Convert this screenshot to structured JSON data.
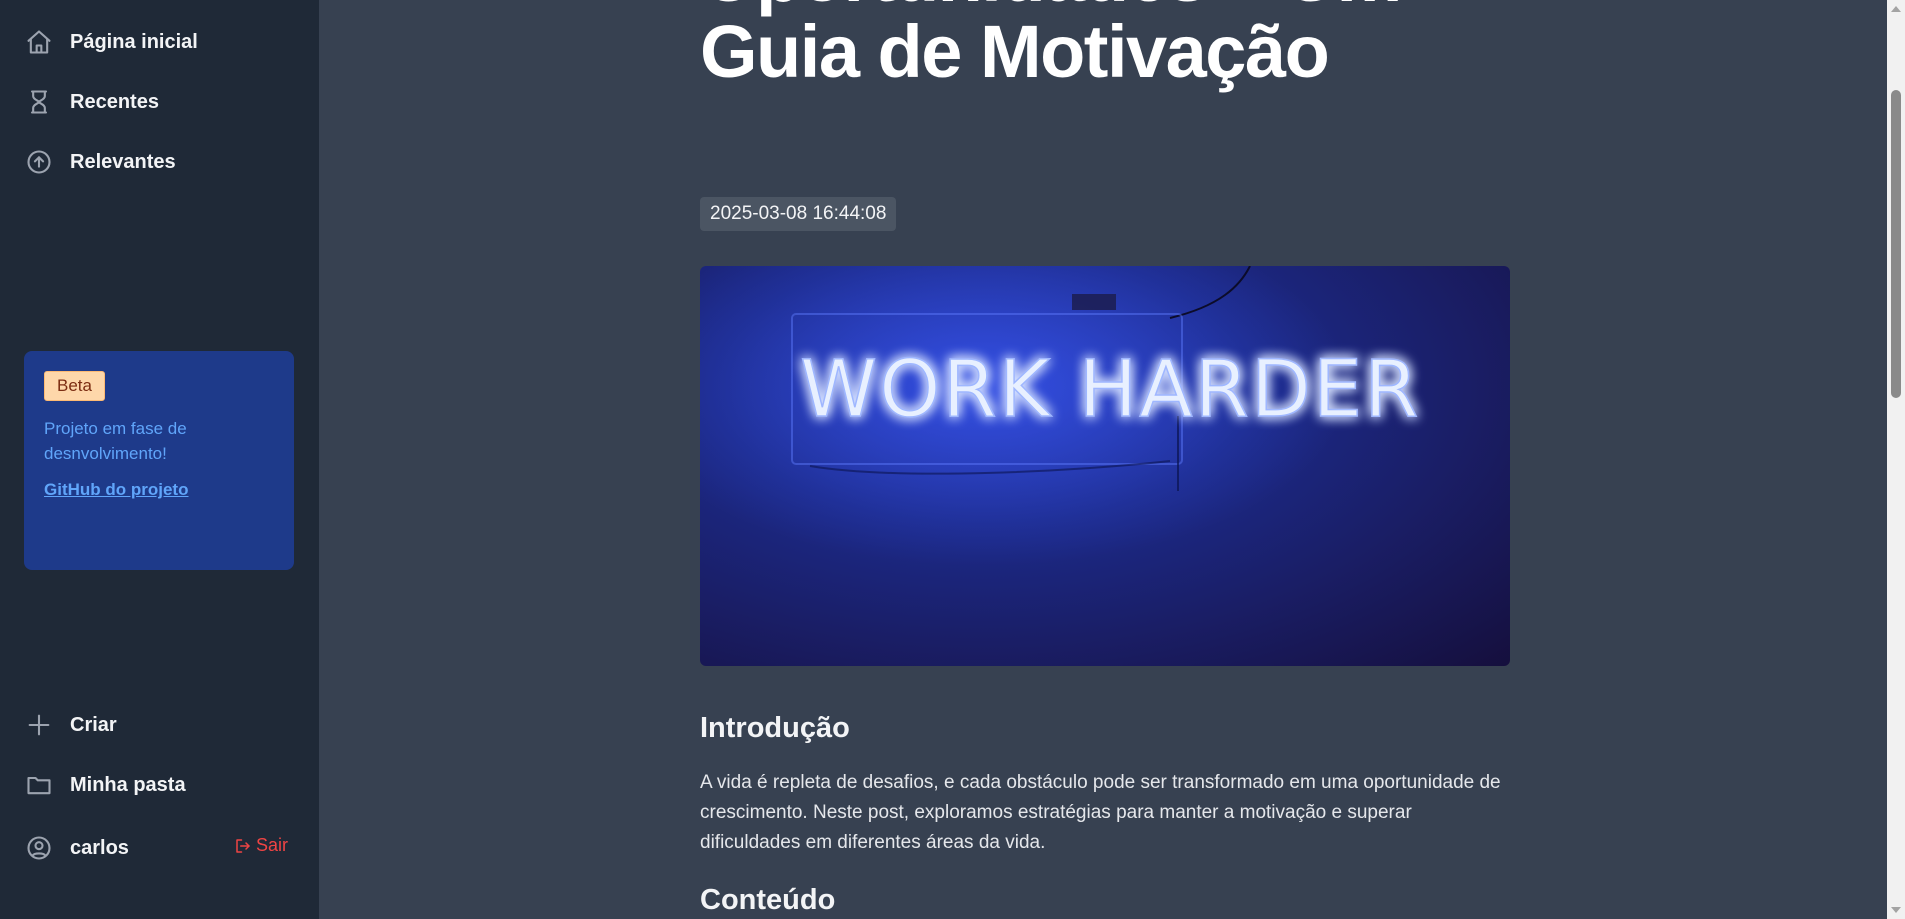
{
  "sidebar": {
    "items": [
      {
        "label": "Página inicial",
        "icon": "home-icon"
      },
      {
        "label": "Recentes",
        "icon": "hourglass-icon"
      },
      {
        "label": "Relevantes",
        "icon": "arrow-up-circle-icon"
      }
    ],
    "beta": {
      "badge": "Beta",
      "text": "Projeto em fase de desnvolvimento!",
      "link": "GitHub do projeto"
    },
    "bottom": [
      {
        "label": "Criar",
        "icon": "plus-icon"
      },
      {
        "label": "Minha pasta",
        "icon": "folder-icon"
      }
    ],
    "user": {
      "name": "carlos",
      "icon": "user-circle-icon"
    },
    "logout": {
      "label": "Sair",
      "icon": "logout-icon"
    }
  },
  "article": {
    "title": "Oportunidades – Um Guia de Motivação",
    "date": "2025-03-08 16:44:08",
    "image": {
      "sign_text": "WORK HARDER"
    },
    "intro_heading": "Introdução",
    "intro_text": "A vida é repleta de desafios, e cada obstáculo pode ser transformado em uma oportunidade de crescimento. Neste post, exploramos estratégias para manter a motivação e superar dificuldades em diferentes áreas da vida.",
    "content_heading": "Conteúdo"
  },
  "colors": {
    "sidebar_bg": "#1f2937",
    "main_bg": "#374151",
    "beta_card_bg": "#1e3a8a",
    "link": "#60a5fa",
    "logout": "#ef4444"
  }
}
